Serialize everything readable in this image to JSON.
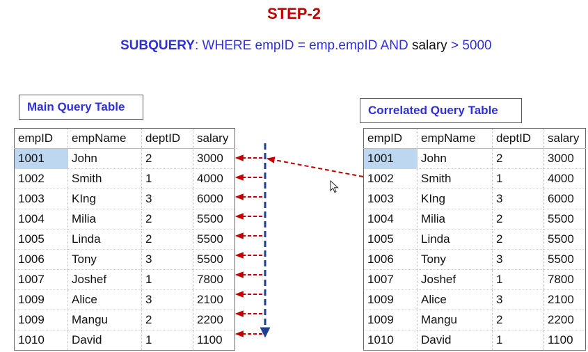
{
  "title": "STEP-2",
  "subquery": {
    "keyword": "SUBQUERY",
    "condition_part1": ":  WHERE empID = emp.empID  AND ",
    "condition_salary": "salary",
    "condition_part2": " > 5000"
  },
  "main_table": {
    "label": "Main Query Table",
    "columns": [
      "empID",
      "empName",
      "deptID",
      "salary"
    ],
    "rows": [
      [
        "1001",
        "John",
        "2",
        "3000"
      ],
      [
        "1002",
        "Smith",
        "1",
        "4000"
      ],
      [
        "1003",
        "KIng",
        "3",
        "6000"
      ],
      [
        "1004",
        "Milia",
        "2",
        "5500"
      ],
      [
        "1005",
        "Linda",
        "2",
        "5500"
      ],
      [
        "1006",
        "Tony",
        "3",
        "5500"
      ],
      [
        "1007",
        "Joshef",
        "1",
        "7800"
      ],
      [
        "1009",
        "Alice",
        "3",
        "2100"
      ],
      [
        "1009",
        "Mangu",
        "2",
        "2200"
      ],
      [
        "1010",
        "David",
        "1",
        "1100"
      ]
    ]
  },
  "correlated_table": {
    "label": "Correlated Query Table",
    "columns": [
      "empID",
      "empName",
      "deptID",
      "salary"
    ],
    "rows": [
      [
        "1001",
        "John",
        "2",
        "3000"
      ],
      [
        "1002",
        "Smith",
        "1",
        "4000"
      ],
      [
        "1003",
        "KIng",
        "3",
        "6000"
      ],
      [
        "1004",
        "Milia",
        "2",
        "5500"
      ],
      [
        "1005",
        "Linda",
        "2",
        "5500"
      ],
      [
        "1006",
        "Tony",
        "3",
        "5500"
      ],
      [
        "1007",
        "Joshef",
        "1",
        "7800"
      ],
      [
        "1009",
        "Alice",
        "3",
        "2100"
      ],
      [
        "1009",
        "Mangu",
        "2",
        "2200"
      ],
      [
        "1010",
        "David",
        "1",
        "1100"
      ]
    ]
  },
  "colors": {
    "title": "#c00000",
    "subquery_text": "#2f2fd6",
    "arrow_red": "#c00000",
    "arrow_blue": "#1f3f8f",
    "selection": "#bcd7ef"
  },
  "icons": {
    "pointer": "mouse-pointer-icon"
  }
}
